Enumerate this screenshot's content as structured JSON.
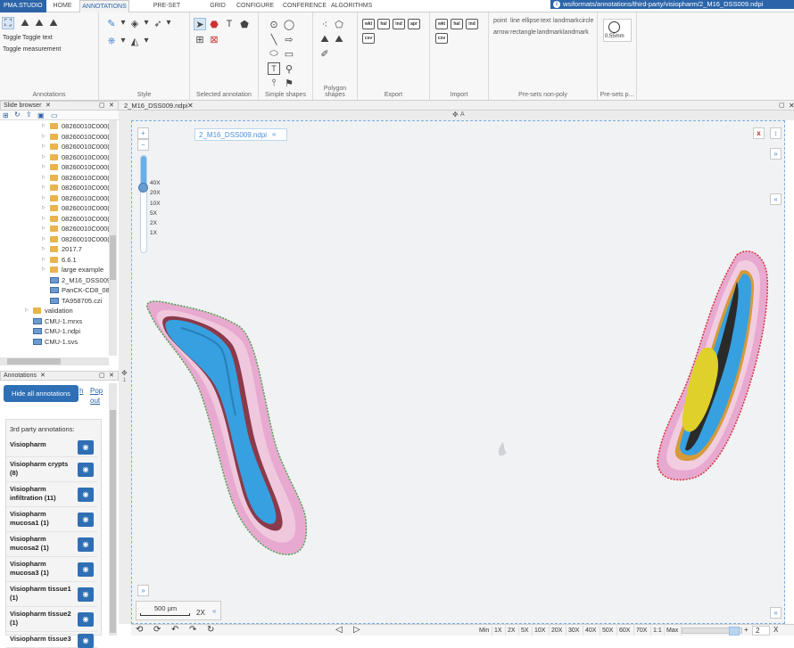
{
  "tabs": {
    "brand": "PMA.STUDIO",
    "home": "HOME",
    "annotations": "ANNOTATIONS",
    "preset": "PRE-SET ANNOTATION",
    "grid": "GRID",
    "configure": "CONFIGURE",
    "conference": "CONFERENCE",
    "algorithms": "ALGORITHMS"
  },
  "path": "wsiformats/annotations/third-party/visiopharm/2_M16_DSS009.ndpi",
  "ribbon": {
    "toggle": "Toggle",
    "toggle_text": "Toggle text",
    "toggle_measurement": "Toggle measurement",
    "groups": {
      "annotations": "Annotations",
      "style": "Style",
      "selected": "Selected annotation",
      "simple": "Simple shapes",
      "polygon": "Polygon shapes",
      "export": "Export",
      "import": "Import",
      "presets_nonpoly": "Pre-sets non-poly",
      "presets_p": "Pre-sets p..."
    },
    "export_labels": [
      "wkt",
      "hal",
      "ind",
      "apr",
      "csv"
    ],
    "import_labels": [
      "wkt",
      "hal",
      "ind",
      "csv"
    ],
    "presets": [
      "point",
      "line",
      "ellipse",
      "text",
      "landmark",
      "circle",
      "arrow",
      "rectangle",
      "landmark",
      "landmark"
    ],
    "preset_size": "0.55mm"
  },
  "slide_browser": {
    "title": "Slide browser",
    "items": [
      {
        "label": "08260010C000(",
        "type": "folder"
      },
      {
        "label": "08260010C000(",
        "type": "folder"
      },
      {
        "label": "08260010C000(",
        "type": "folder"
      },
      {
        "label": "08260010C000(",
        "type": "folder"
      },
      {
        "label": "08260010C000(",
        "type": "folder"
      },
      {
        "label": "08260010C000(",
        "type": "folder"
      },
      {
        "label": "08260010C000(",
        "type": "folder"
      },
      {
        "label": "08260010C000(",
        "type": "folder"
      },
      {
        "label": "08260010C000(",
        "type": "folder"
      },
      {
        "label": "08260010C000(",
        "type": "folder"
      },
      {
        "label": "08260010C000(",
        "type": "folder"
      },
      {
        "label": "08260010C000(",
        "type": "folder"
      },
      {
        "label": "2017.7",
        "type": "folder"
      },
      {
        "label": "6.6.1",
        "type": "folder"
      },
      {
        "label": "large example",
        "type": "folder"
      },
      {
        "label": "2_M16_DSS009",
        "type": "file"
      },
      {
        "label": "PanCK-CD8_082",
        "type": "file"
      },
      {
        "label": "TA958705.czi",
        "type": "file"
      },
      {
        "label": "validation",
        "type": "folder2"
      },
      {
        "label": "CMU-1.mrxs",
        "type": "file2"
      },
      {
        "label": "CMU-1.ndpi",
        "type": "file2"
      },
      {
        "label": "CMU-1.svs",
        "type": "file2"
      }
    ]
  },
  "annotations_panel": {
    "title": "Annotations",
    "hide_all": "Hide all annotations",
    "refresh": "h",
    "popout": "Pop out",
    "section": "3rd party annotations:",
    "items": [
      "Visiopharm",
      "Visiopharm crypts (8)",
      "Visiopharm infiltration (11)",
      "Visiopharm mucosa1 (1)",
      "Visiopharm mucosa2 (1)",
      "Visiopharm mucosa3 (1)",
      "Visiopharm tissue1 (1)",
      "Visiopharm tissue2 (1)",
      "Visiopharm tissue3"
    ]
  },
  "viewer": {
    "doc_tab": "2_M16_DSS009.ndpi",
    "slide_label": "2_M16_DSS009.ndpi",
    "top_marker": "A",
    "zoom_levels": [
      "40X",
      "20X",
      "10X",
      "5X",
      "2X",
      "1X"
    ],
    "zoom_fraction": 0.33,
    "scale_bar": "500 µm",
    "scale_zoom": "2X",
    "close_x": "x"
  },
  "bottom": {
    "zooms": [
      "Min",
      "1X",
      "2X",
      "5X",
      "10X",
      "20X",
      "30X",
      "40X",
      "50X",
      "60X",
      "70X",
      "1:1",
      "Max"
    ],
    "page": "2",
    "close": "X"
  }
}
